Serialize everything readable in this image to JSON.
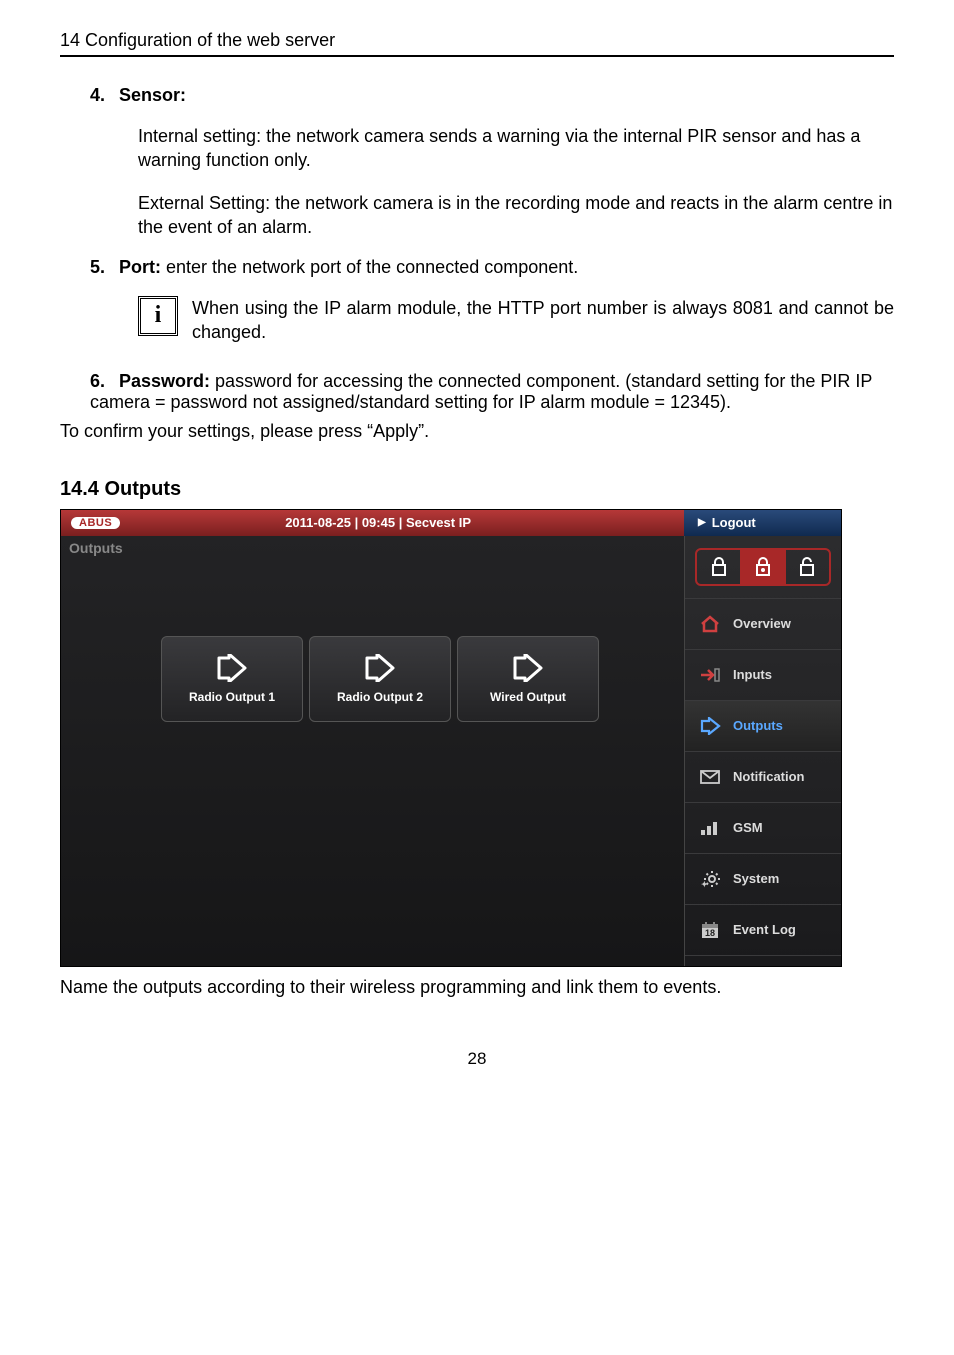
{
  "header": "14  Configuration of the web server",
  "items": {
    "i4": {
      "num": "4.",
      "label": "Sensor:",
      "p1": "Internal setting: the network camera sends a warning via the internal PIR sensor and has a warning function only.",
      "p2": "External Setting: the network camera is in the recording mode and reacts in the alarm centre in the event of an alarm."
    },
    "i5": {
      "num": "5.",
      "label": "Port:",
      "rest": " enter the network port of the connected component.",
      "info": "When using the IP alarm module, the HTTP port number is always 8081 and cannot be changed."
    },
    "i6": {
      "num": "6.",
      "label": "Password:",
      "rest": " password for accessing the connected component. (standard setting for the PIR IP camera = password not assigned/standard setting for IP alarm module = 12345)."
    }
  },
  "confirm": "To confirm your settings, please press “Apply”.",
  "section": "14.4   Outputs",
  "ss": {
    "logo": "ABUS",
    "title": "2011-08-25  |  09:45  |  Secvest IP",
    "logout": "Logout",
    "subtitle": "Outputs",
    "tiles": {
      "t1": "Radio Output 1",
      "t2": "Radio Output 2",
      "t3": "Wired Output"
    },
    "nav": {
      "overview": "Overview",
      "inputs": "Inputs",
      "outputs": "Outputs",
      "notification": "Notification",
      "gsm": "GSM",
      "system": "System",
      "eventlog": "Event Log"
    }
  },
  "caption": "Name the outputs according to their wireless programming and link them to events.",
  "pagenum": "28"
}
